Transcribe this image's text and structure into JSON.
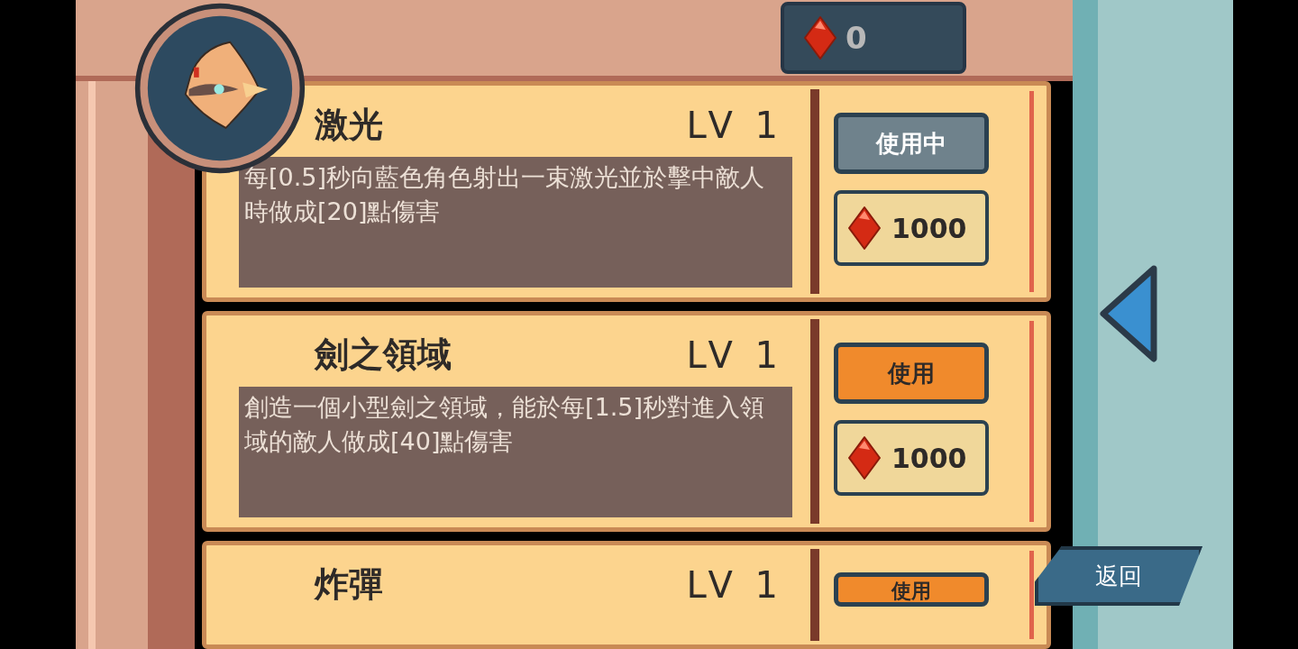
{
  "currency": {
    "amount": "0"
  },
  "skills": [
    {
      "name": "激光",
      "level": "LV 1",
      "description": "每[0.5]秒向藍色角色射出一束激光並於擊中敵人時做成[20]點傷害",
      "selected": true,
      "action": "使用中",
      "price": "1000"
    },
    {
      "name": "劍之領域",
      "level": "LV 1",
      "description": "創造一個小型劍之領域，能於每[1.5]秒對進入領域的敵人做成[40]點傷害",
      "selected": false,
      "action": "使用",
      "price": "1000"
    },
    {
      "name": "炸彈",
      "level": "LV 1",
      "selected": false,
      "action": "使用"
    }
  ],
  "back_button": {
    "label": "返回"
  }
}
